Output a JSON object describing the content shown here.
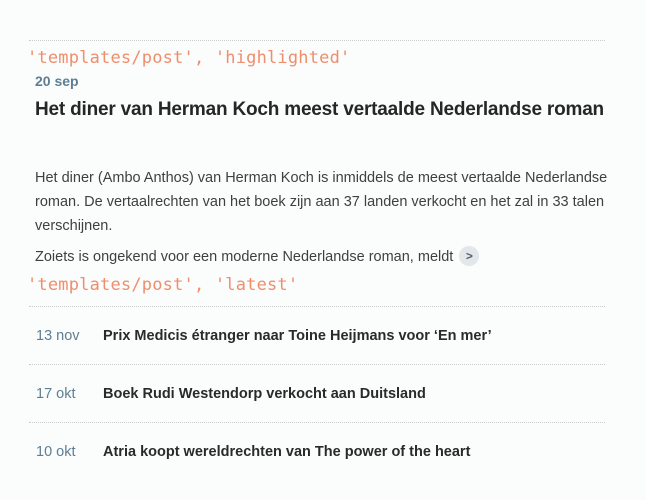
{
  "highlighted": {
    "template_label": "'templates/post', 'highlighted'",
    "date": "20 sep",
    "title": "Het diner van Herman Koch meest vertaalde Nederlandse roman",
    "paragraph1": "Het diner (Ambo Anthos) van Herman Koch is inmiddels de meest vertaalde Nederlandse roman. De vertaalrechten van het boek zijn aan 37 landen verkocht en het zal in 33 talen verschijnen.",
    "paragraph2": "Zoiets is ongekend voor een moderne Nederlandse roman, meldt",
    "more_label": ">"
  },
  "latest": {
    "template_label": "'templates/post', 'latest'",
    "items": [
      {
        "date": "13 nov",
        "title": "Prix Medicis étranger naar Toine Heijmans voor ‘En mer’"
      },
      {
        "date": "17 okt",
        "title": "Boek Rudi Westendorp verkocht aan Duitsland"
      },
      {
        "date": "10 okt",
        "title": "Atria koopt wereldrechten van The power of the heart"
      }
    ]
  },
  "colors": {
    "code": "#ef8e6d",
    "date": "#5e7e93",
    "background": "#fbfcfc"
  }
}
